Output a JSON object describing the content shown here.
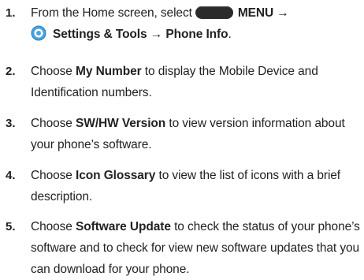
{
  "steps": [
    {
      "number": "1.",
      "line1_pre": "From the Home screen, select",
      "menu_label": "MENU",
      "arrow": "→",
      "settings_label": "Settings & Tools",
      "phone_info_label": "Phone Info",
      "period": ".",
      "icons": [
        "menu-key-icon",
        "settings-gear-icon"
      ]
    },
    {
      "number": "2.",
      "pre": "Choose",
      "bold": "My Number",
      "post": " to display the Mobile Device and Identification numbers."
    },
    {
      "number": "3.",
      "pre": "Choose",
      "bold": "SW/HW Version",
      "post": "to view version information about your phone’s software."
    },
    {
      "number": "4.",
      "pre": "Choose",
      "bold": "Icon Glossary",
      "post": "to view the list of icons with a brief description."
    },
    {
      "number": "5.",
      "pre": "Choose",
      "bold": "Software Update",
      "post": "to check the status of your phone’s software and to check for view new software updates that you can download for your phone."
    }
  ],
  "colors": {
    "text": "#222222",
    "menu_key": "#2b2b2b",
    "gear_blue": "#4aa3df"
  }
}
